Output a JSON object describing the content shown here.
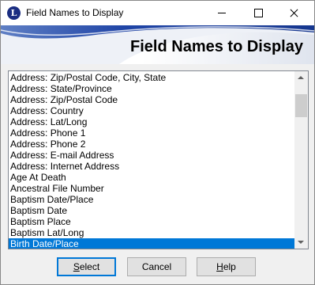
{
  "window": {
    "title": "Field Names to Display",
    "icon": "L",
    "colors": {
      "accent": "#0078d7",
      "banner_blue": "#1b3f9a"
    }
  },
  "banner": {
    "title": "Field Names to Display"
  },
  "list": {
    "items": [
      "Address: Zip/Postal Code, City, State",
      "Address: State/Province",
      "Address: Zip/Postal Code",
      "Address: Country",
      "Address: Lat/Long",
      "Address: Phone 1",
      "Address: Phone 2",
      "Address: E-mail Address",
      "Address: Internet Address",
      "Age At Death",
      "Ancestral File Number",
      "Baptism Date/Place",
      "Baptism Date",
      "Baptism Place",
      "Baptism Lat/Long",
      "Birth Date/Place"
    ],
    "selected": "Birth Date/Place"
  },
  "buttons": {
    "select": {
      "first": "S",
      "rest": "elect"
    },
    "cancel": {
      "label": "Cancel"
    },
    "help": {
      "first": "H",
      "rest": "elp"
    }
  }
}
